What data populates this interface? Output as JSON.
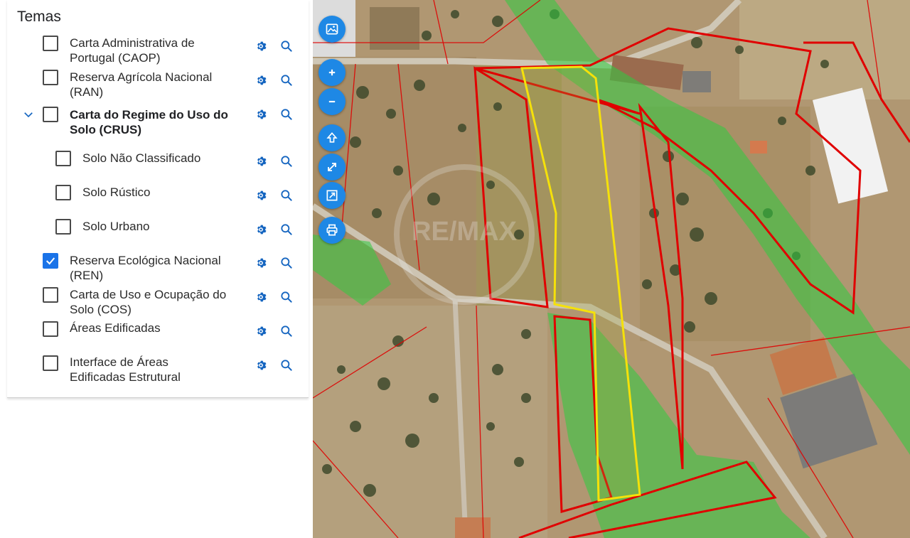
{
  "panel": {
    "title": "Temas",
    "layers": [
      {
        "name": "Carta Administrativa de Portugal (CAOP)",
        "line1": "Carta Administrativa de",
        "line2": "Portugal (CAOP)",
        "checked": false
      },
      {
        "name": "Reserva Agrícola Nacional (RAN)",
        "line1": "Reserva Agrícola Nacional",
        "line2": "(RAN)",
        "checked": false
      },
      {
        "name": "Carta do Regime do Uso do Solo (CRUS)",
        "line1": "Carta do Regime do Uso do",
        "line2": "Solo (CRUS)",
        "checked": false,
        "expanded": true,
        "children": [
          {
            "label": "Solo Não Classificado",
            "checked": false
          },
          {
            "label": "Solo Rústico",
            "checked": false
          },
          {
            "label": "Solo Urbano",
            "checked": false
          }
        ]
      },
      {
        "name": "Reserva Ecológica Nacional (REN)",
        "line1": "Reserva Ecológica Nacional",
        "line2": "(REN)",
        "checked": true
      },
      {
        "name": "Carta de Uso e Ocupação do Solo (COS)",
        "line1": "Carta de Uso e Ocupação do",
        "line2": "Solo (COS)",
        "checked": false
      },
      {
        "name": "Áreas Edificadas",
        "line1": "Áreas Edificadas",
        "line2": "",
        "checked": false
      },
      {
        "name": "Interface de Áreas Edificadas Estrutural",
        "line1": "Interface de Áreas",
        "line2": "Edificadas Estrutural",
        "checked": false
      }
    ]
  },
  "map_controls": [
    "basemap-icon",
    "zoom-in-icon",
    "zoom-out-icon",
    "home-icon",
    "fullscreen-icon",
    "zoom-extent-icon",
    "print-icon"
  ],
  "map": {
    "watermark": "RE/MAX"
  },
  "colors": {
    "accent": "#1a73e8",
    "button": "#1e88e5",
    "parcel_outline": "#e00000",
    "highlight_outline": "#f5e10a",
    "ren_fill": "#2ecc40"
  }
}
